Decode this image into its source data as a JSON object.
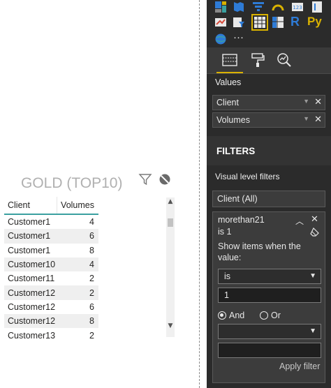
{
  "visual": {
    "title": "GOLD (TOP10)",
    "columns": [
      "Client",
      "Volumes"
    ],
    "rows": [
      {
        "client": "Customer1",
        "volumes": "4"
      },
      {
        "client": "Customer1",
        "volumes": "6"
      },
      {
        "client": "Customer1",
        "volumes": "8"
      },
      {
        "client": "Customer10",
        "volumes": "4"
      },
      {
        "client": "Customer11",
        "volumes": "2"
      },
      {
        "client": "Customer12",
        "volumes": "2"
      },
      {
        "client": "Customer12",
        "volumes": "6"
      },
      {
        "client": "Customer12",
        "volumes": "8"
      },
      {
        "client": "Customer13",
        "volumes": "2"
      }
    ],
    "header_accent": "#3aa0a0"
  },
  "pane": {
    "values_label": "Values",
    "fields": [
      {
        "label": "Client"
      },
      {
        "label": "Volumes"
      }
    ],
    "r_icon": "R",
    "py_icon": "Py",
    "more_icon": "···",
    "accent": "#d9b200"
  },
  "filters": {
    "title": "FILTERS",
    "section_label": "Visual level filters",
    "client_card": "Client  (All)",
    "measure_card": {
      "name": "morethan21",
      "summary": "is 1",
      "show_text": "Show items when the value:",
      "operator": "is",
      "value": "1",
      "and_label": "And",
      "or_label": "Or",
      "apply_label": "Apply filter"
    }
  }
}
